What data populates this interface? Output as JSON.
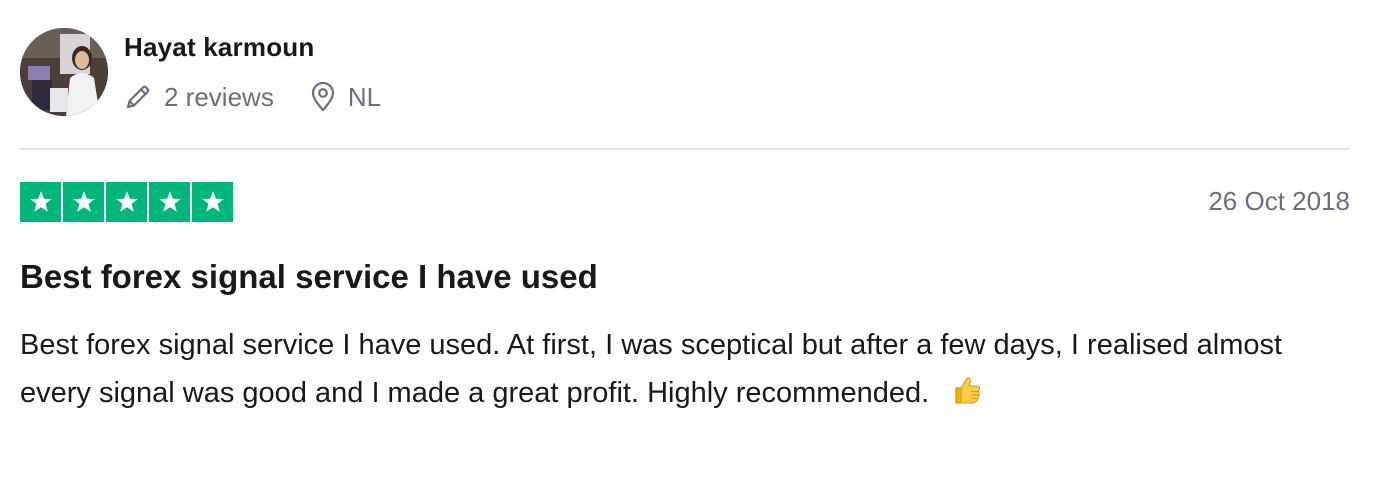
{
  "reviewer": {
    "name": "Hayat karmoun",
    "reviews_count": "2 reviews",
    "location": "NL"
  },
  "review": {
    "rating": 5,
    "rating_color": "#00b67a",
    "date": "26 Oct 2018",
    "title": "Best forex signal service I have used",
    "body": "Best forex signal service I have used. At first, I was sceptical but after a few days, I realised almost every signal was good and I made a great profit. Highly recommended.",
    "emoji_icon": "thumbs-up-icon"
  },
  "icons": {
    "reviews": "pencil-icon",
    "location": "location-pin-icon",
    "star": "star-icon"
  },
  "colors": {
    "text": "#191919",
    "muted": "#6c6c85",
    "divider": "#e5e5dd"
  }
}
